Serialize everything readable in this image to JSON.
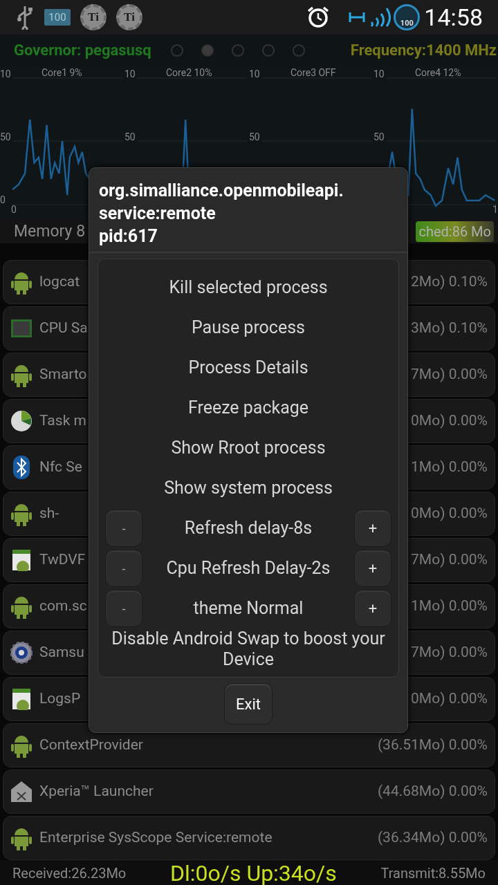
{
  "status_bar": {
    "battery_text": "100",
    "badges": [
      "Ti",
      "Ti"
    ],
    "gauge_text": "100",
    "time": "14:58"
  },
  "header": {
    "governor": "Governor: pegasusq",
    "frequency": "Frequency:1400 MHz",
    "dots": [
      {
        "selected": false
      },
      {
        "selected": true
      },
      {
        "selected": false
      },
      {
        "selected": false
      },
      {
        "selected": false
      }
    ]
  },
  "cores": [
    {
      "title": "Core1 9%",
      "y_labels": [
        "10",
        "50",
        "0"
      ]
    },
    {
      "title": "Core2 10%",
      "y_labels": [
        "10",
        "50"
      ]
    },
    {
      "title": "Core3 OFF",
      "y_labels": [
        "10",
        "50"
      ]
    },
    {
      "title": "Core4 12%",
      "y_labels": [
        "10",
        "50"
      ]
    }
  ],
  "x_labels": [
    "0",
    "1"
  ],
  "memory": {
    "left": "Memory 8",
    "right": "ched:86 Mo"
  },
  "processes": [
    {
      "kind": "android",
      "name": "logcat",
      "usage": "2Mo) 0.10%"
    },
    {
      "kind": "chip",
      "name": "CPU Sa",
      "usage": "3Mo) 0.10%"
    },
    {
      "kind": "android",
      "name": "Smarto",
      "usage": "7Mo) 0.00%"
    },
    {
      "kind": "pie",
      "name": "Task m",
      "usage": "0Mo) 0.00%"
    },
    {
      "kind": "bluetooth",
      "name": "Nfc Se",
      "usage": "1Mo) 0.00%"
    },
    {
      "kind": "android",
      "name": "sh-",
      "usage": "0Mo) 0.00%"
    },
    {
      "kind": "document",
      "name": "TwDVF",
      "usage": "7Mo) 0.00%"
    },
    {
      "kind": "android",
      "name": "com.sc",
      "usage": "1Mo) 0.00%"
    },
    {
      "kind": "gear",
      "name": "Samsu",
      "usage": "7Mo) 0.00%"
    },
    {
      "kind": "document",
      "name": "LogsP",
      "usage": "0Mo) 0.00%"
    },
    {
      "kind": "android",
      "name": "ContextProvider",
      "usage": "(36.51Mo) 0.00%"
    },
    {
      "kind": "house",
      "name": "Xperia™ Launcher",
      "usage": "(44.68Mo) 0.00%"
    },
    {
      "kind": "android",
      "name": "Enterprise SysScope Service:remote",
      "usage": "(36.34Mo) 0.00%"
    }
  ],
  "dialog": {
    "title_lines": [
      "org.simalliance.openmobileapi.",
      "service:remote",
      "pid:617"
    ],
    "options": [
      {
        "kind": "plain",
        "label": "Kill selected process"
      },
      {
        "kind": "plain",
        "label": "Pause process"
      },
      {
        "kind": "plain",
        "label": "Process Details"
      },
      {
        "kind": "plain",
        "label": "Freeze package"
      },
      {
        "kind": "plain",
        "label": "Show Rroot process"
      },
      {
        "kind": "plain",
        "label": "Show system process"
      },
      {
        "kind": "stepper",
        "label": "Refresh delay-8s",
        "minus": "-",
        "plus": "+"
      },
      {
        "kind": "stepper",
        "label": "Cpu Refresh Delay-2s",
        "minus": "-",
        "plus": "+"
      },
      {
        "kind": "stepper",
        "label": "theme Normal",
        "minus": "-",
        "plus": "+"
      },
      {
        "kind": "plain",
        "label": "Disable Android Swap to boost your Device"
      }
    ],
    "exit": "Exit"
  },
  "bottom_bar": {
    "received": "Received:26.23Mo",
    "speed": "Dl:0o/s Up:34o/s",
    "transmit": "Transmit:8.55Mo"
  }
}
